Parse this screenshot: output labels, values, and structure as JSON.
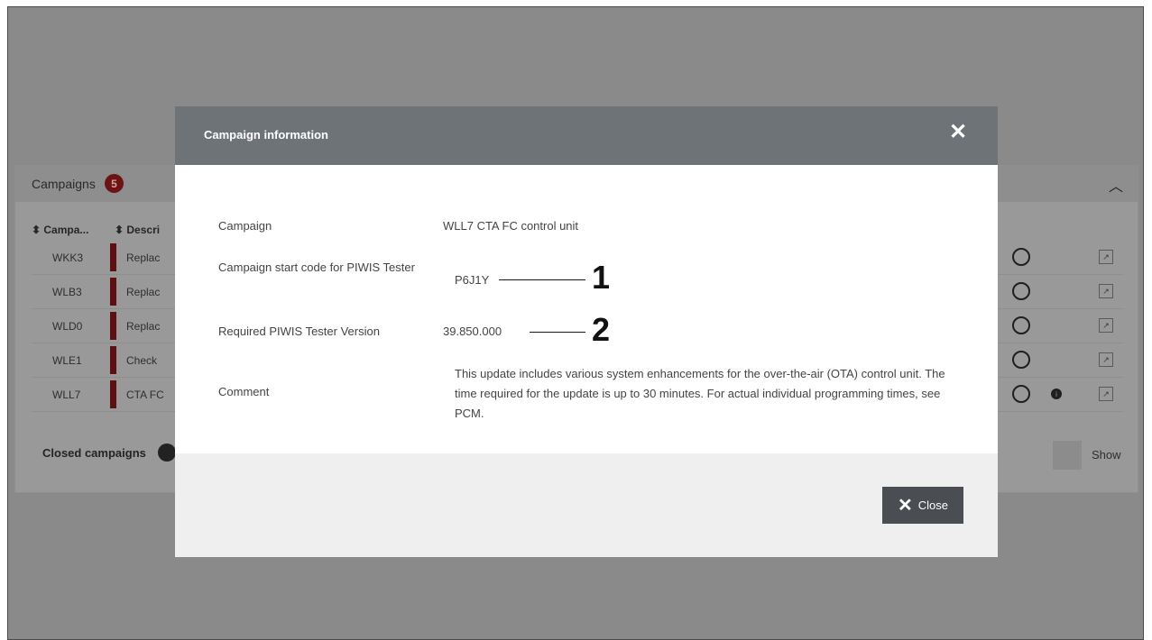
{
  "background": {
    "panel_title": "Campaigns",
    "badge_count": "5",
    "columns": [
      "Campa...",
      "Descri"
    ],
    "rows": [
      {
        "code": "WKK3",
        "desc": "Replac"
      },
      {
        "code": "WLB3",
        "desc": "Replac"
      },
      {
        "code": "WLD0",
        "desc": "Replac"
      },
      {
        "code": "WLE1",
        "desc": "Check"
      },
      {
        "code": "WLL7",
        "desc": "CTA FC"
      }
    ],
    "closed_label": "Closed campaigns",
    "show_label": "Show"
  },
  "modal": {
    "title": "Campaign information",
    "fields": [
      {
        "label": "Campaign",
        "value": "WLL7 CTA FC control unit"
      },
      {
        "label": "Campaign start code for PIWIS Tester",
        "value": "P6J1Y"
      },
      {
        "label": "Required PIWIS Tester Version",
        "value": "39.850.000"
      },
      {
        "label": "Comment",
        "value": "This update includes various system enhancements for the over-the-air (OTA) control unit. The time required for the update is up to 30 minutes. For actual individual programming times, see PCM."
      }
    ],
    "callouts": [
      "1",
      "2"
    ],
    "close_label": "Close"
  },
  "colors": {
    "overlay": "#8a8a8a",
    "modal_header": "#6e7377",
    "close_button": "#4a4d51",
    "campaign_bar": "#5d0f12"
  }
}
